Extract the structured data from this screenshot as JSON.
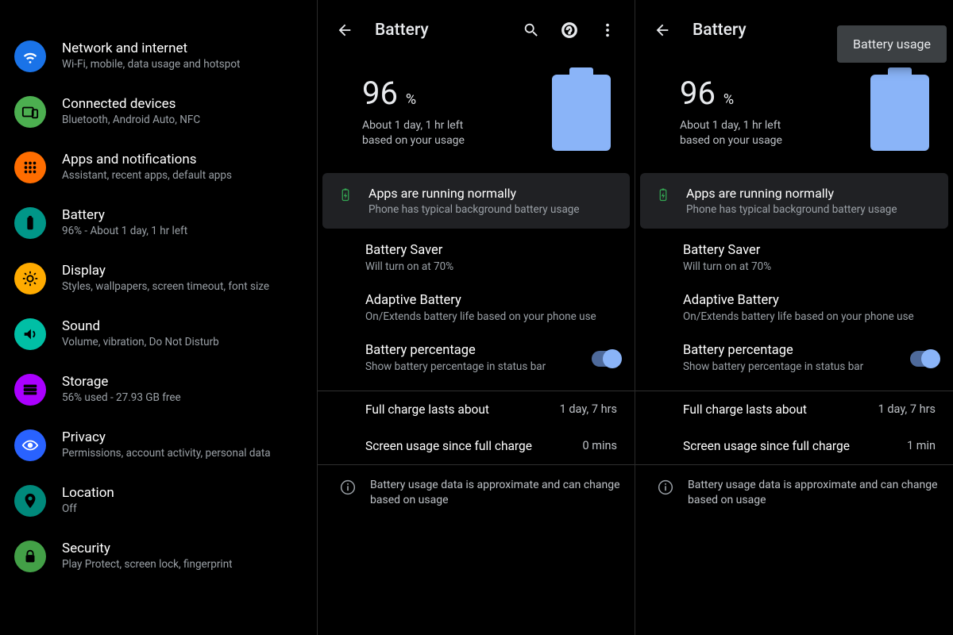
{
  "settings": {
    "items": [
      {
        "title": "Network and internet",
        "sub": "Wi-Fi, mobile, data usage and hotspot",
        "icon": "wifi",
        "bg": "#1a73e8"
      },
      {
        "title": "Connected devices",
        "sub": "Bluetooth, Android Auto, NFC",
        "icon": "devices",
        "bg": "#4caf50"
      },
      {
        "title": "Apps and notifications",
        "sub": "Assistant, recent apps, default apps",
        "icon": "apps",
        "bg": "#ff6d00"
      },
      {
        "title": "Battery",
        "sub": "96% - About 1 day, 1 hr left",
        "icon": "battery",
        "bg": "#009688"
      },
      {
        "title": "Display",
        "sub": "Styles, wallpapers, screen timeout, font size",
        "icon": "display",
        "bg": "#ffab00"
      },
      {
        "title": "Sound",
        "sub": "Volume, vibration, Do Not Disturb",
        "icon": "sound",
        "bg": "#00bfa5"
      },
      {
        "title": "Storage",
        "sub": "56% used - 27.93 GB free",
        "icon": "storage",
        "bg": "#aa00ff"
      },
      {
        "title": "Privacy",
        "sub": "Permissions, account activity, personal data",
        "icon": "privacy",
        "bg": "#2962ff"
      },
      {
        "title": "Location",
        "sub": "Off",
        "icon": "location",
        "bg": "#00897b"
      },
      {
        "title": "Security",
        "sub": "Play Protect, screen lock, fingerprint",
        "icon": "security",
        "bg": "#43a047"
      }
    ]
  },
  "battery": {
    "title": "Battery",
    "percent": "96",
    "percent_sym": "%",
    "estimate": "About 1 day, 1 hr left\nbased on your usage",
    "card_title": "Apps are running normally",
    "card_sub": "Phone has typical background battery usage",
    "rows": {
      "saver": {
        "title": "Battery Saver",
        "sub": "Will turn on at 70%"
      },
      "adaptive": {
        "title": "Adaptive Battery",
        "sub": "On/Extends battery life based on your phone use"
      },
      "percent": {
        "title": "Battery percentage",
        "sub": "Show battery percentage in status bar"
      }
    },
    "stats_mid": {
      "full": {
        "label": "Full charge lasts about",
        "value": "1 day, 7 hrs"
      },
      "screen": {
        "label": "Screen usage since full charge",
        "value": "0 mins"
      }
    },
    "stats_right": {
      "full": {
        "label": "Full charge lasts about",
        "value": "1 day, 7 hrs"
      },
      "screen": {
        "label": "Screen usage since full charge",
        "value": "1 min"
      }
    },
    "note": "Battery usage data is approximate and can change based on usage",
    "menu_item": "Battery usage"
  }
}
